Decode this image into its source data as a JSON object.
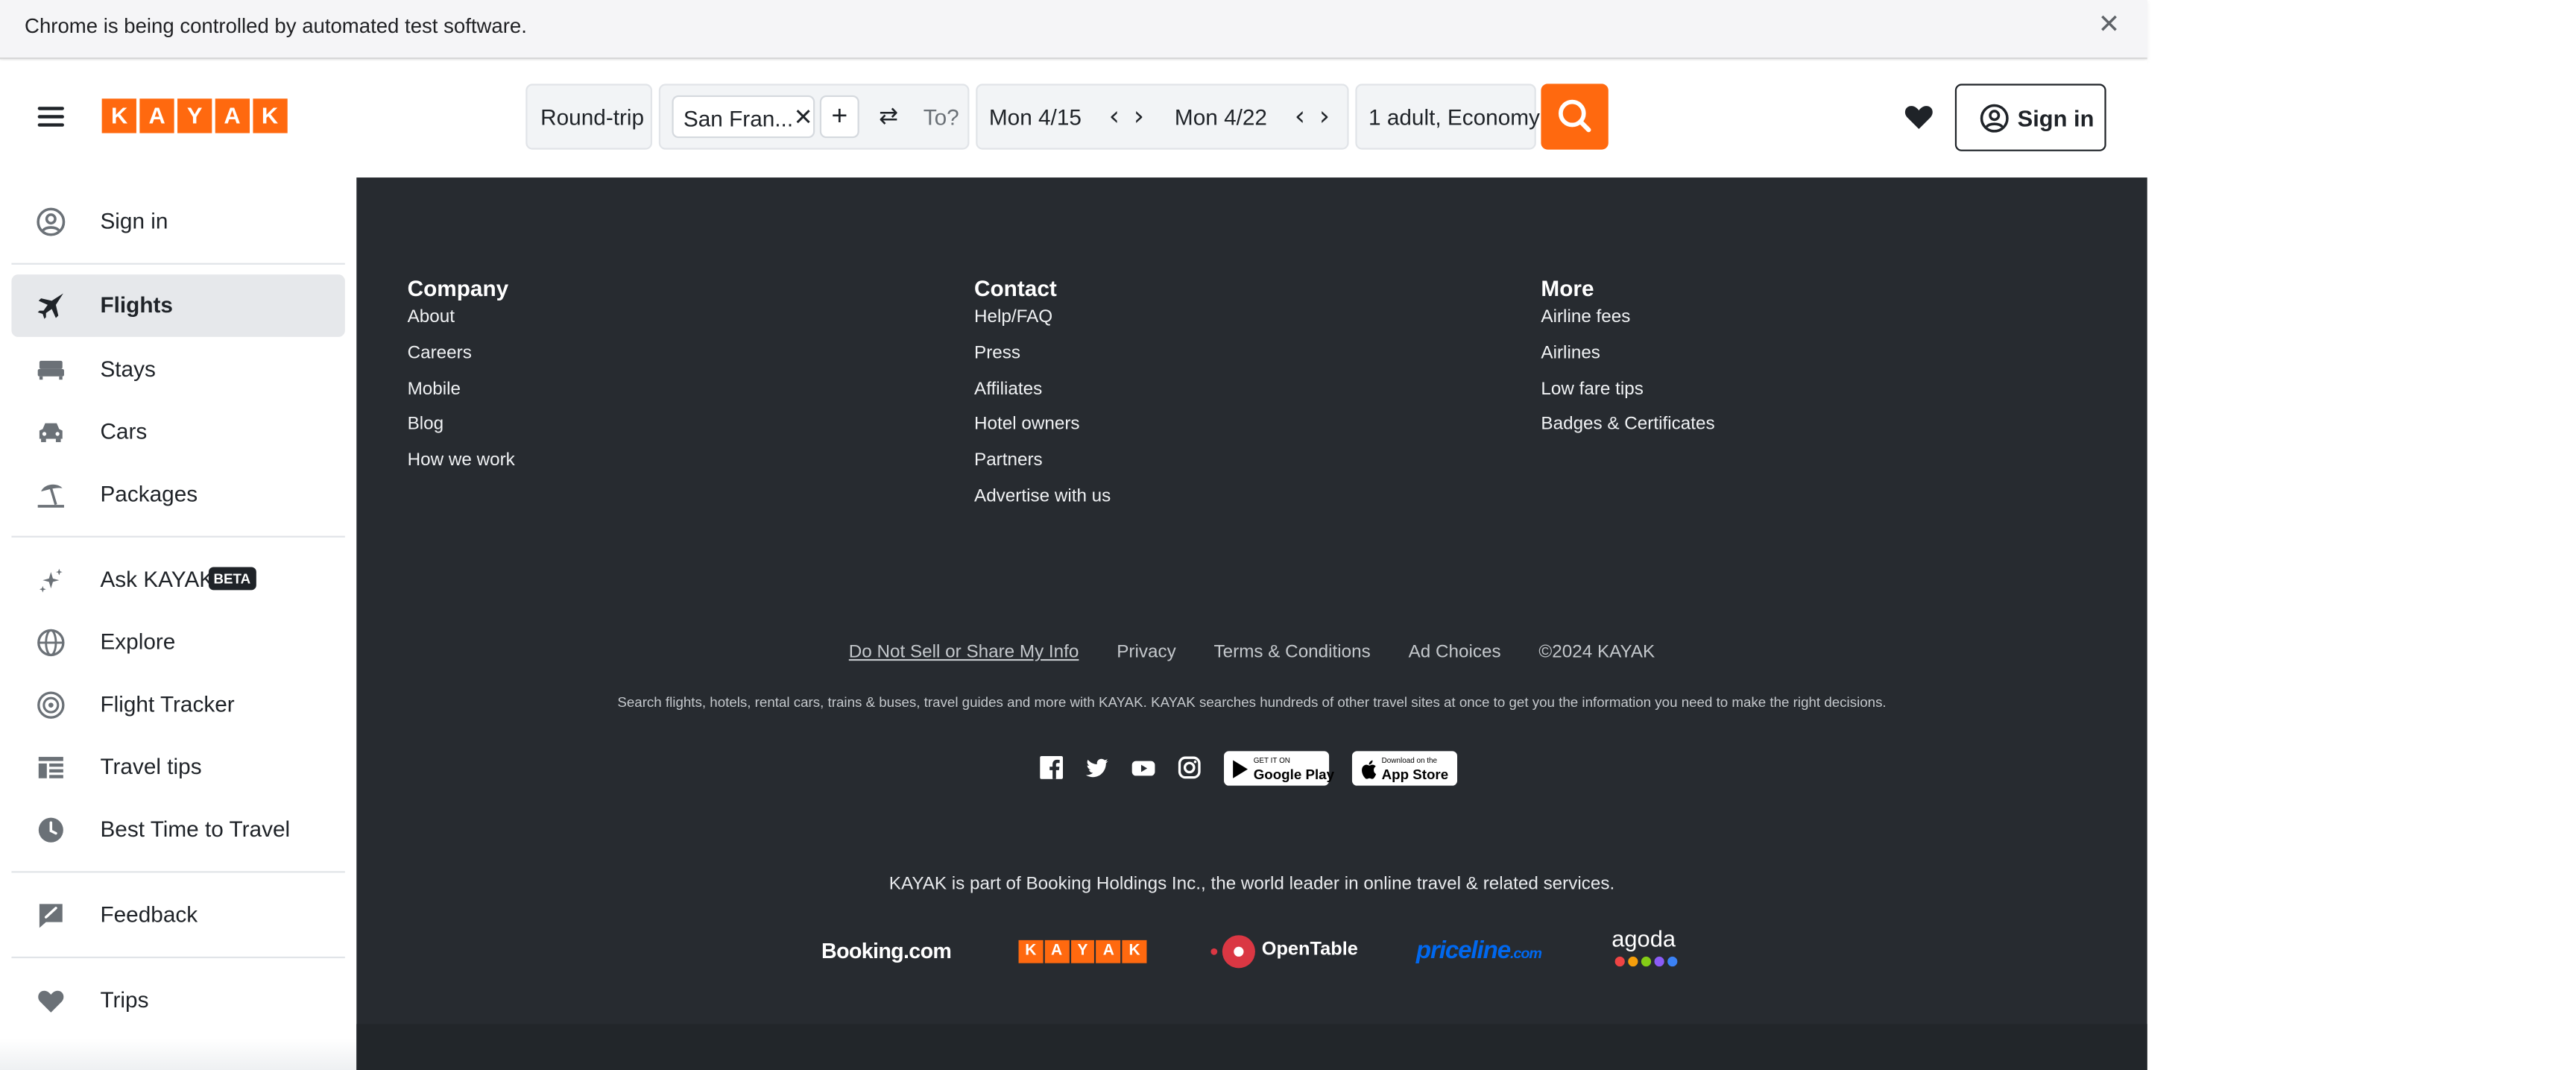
{
  "infobar": {
    "text": "Chrome is being controlled by automated test software.",
    "close_symbol": "✕"
  },
  "header": {
    "logo_letters": [
      "K",
      "A",
      "Y",
      "A",
      "K"
    ],
    "trip_type": "Round-trip",
    "origin": "San Fran...",
    "origin_clear": "✕",
    "add_symbol": "+",
    "swap_symbol": "⇄",
    "destination_placeholder": "To?",
    "depart_date": "Mon 4/15",
    "return_date": "Mon 4/22",
    "prev_symbol": "‹",
    "next_symbol": "›",
    "travelers": "1 adult, Economy",
    "sign_in": "Sign in"
  },
  "sidebar": {
    "sign_in": "Sign in",
    "items": [
      {
        "label": "Flights",
        "icon": "airplane-icon"
      },
      {
        "label": "Stays",
        "icon": "bed-icon"
      },
      {
        "label": "Cars",
        "icon": "car-icon"
      },
      {
        "label": "Packages",
        "icon": "palm-umbrella-icon"
      }
    ],
    "ask": {
      "label": "Ask KAYAK",
      "badge": "BETA"
    },
    "tools": [
      {
        "label": "Explore",
        "icon": "globe-icon"
      },
      {
        "label": "Flight Tracker",
        "icon": "radar-icon"
      },
      {
        "label": "Travel tips",
        "icon": "list-icon"
      },
      {
        "label": "Best Time to Travel",
        "icon": "clock-icon"
      }
    ],
    "feedback": "Feedback",
    "trips": "Trips"
  },
  "footer": {
    "columns": [
      {
        "title": "Company",
        "links": [
          "About",
          "Careers",
          "Mobile",
          "Blog",
          "How we work"
        ]
      },
      {
        "title": "Contact",
        "links": [
          "Help/FAQ",
          "Press",
          "Affiliates",
          "Hotel owners",
          "Partners",
          "Advertise with us"
        ]
      },
      {
        "title": "More",
        "links": [
          "Airline fees",
          "Airlines",
          "Low fare tips",
          "Badges & Certificates"
        ]
      }
    ],
    "legal": {
      "do_not_sell": "Do Not Sell or Share My Info",
      "privacy": "Privacy",
      "terms": "Terms & Conditions",
      "ad_choices": "Ad Choices",
      "copyright": "©2024 KAYAK"
    },
    "tagline": "Search flights, hotels, rental cars, trains & buses, travel guides and more with KAYAK. KAYAK searches hundreds of other travel sites at once to get you the information you need to make the right decisions.",
    "social_icons": [
      "facebook-icon",
      "twitter-icon",
      "youtube-icon",
      "instagram-icon"
    ],
    "google_play": {
      "small": "GET IT ON",
      "big": "Google Play"
    },
    "app_store": {
      "small": "Download on the",
      "big": "App Store"
    },
    "part_of": "KAYAK is part of Booking Holdings Inc., the world leader in online travel & related services.",
    "brands": {
      "booking": "Booking.com",
      "kayak_letters": [
        "K",
        "A",
        "Y",
        "A",
        "K"
      ],
      "opentable": "OpenTable",
      "opentable_mark": "·",
      "priceline": "priceline",
      "priceline_suffix": ".com",
      "agoda": "agoda"
    }
  },
  "colors": {
    "brand_orange": "#ff690f",
    "footer_bg": "#272b30",
    "priceline_blue": "#0068ef",
    "opentable_red": "#da3743",
    "agoda_dots": [
      "#ef4444",
      "#f59e0b",
      "#84cc16",
      "#8b5cf6",
      "#3b82f6"
    ]
  }
}
